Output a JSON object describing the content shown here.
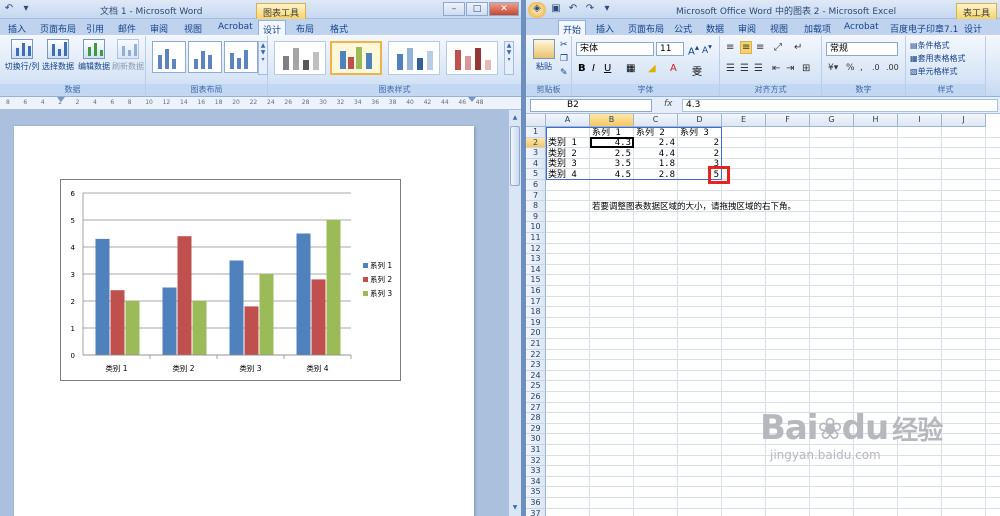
{
  "word": {
    "title": "文档 1 - Microsoft Word",
    "context_tab": "图表工具",
    "tabs": [
      "插入",
      "页面布局",
      "引用",
      "邮件",
      "审阅",
      "视图",
      "Acrobat",
      "设计",
      "布局",
      "格式"
    ],
    "active_tab": "设计",
    "data_group": {
      "label": "数据",
      "buttons": [
        "切换行/列",
        "选择数据",
        "编辑数据",
        "刷新数据"
      ]
    },
    "layout_group_label": "图表布局",
    "styles_group_label": "图表样式",
    "ruler_numbers": [
      "8",
      "6",
      "4",
      "2",
      "2",
      "4",
      "6",
      "8",
      "10",
      "12",
      "14",
      "16",
      "18",
      "20",
      "22",
      "24",
      "26",
      "28",
      "30",
      "32",
      "34",
      "36",
      "38",
      "40",
      "42",
      "44",
      "46",
      "48"
    ]
  },
  "excel": {
    "title": "Microsoft Office Word 中的图表 2 - Microsoft Excel",
    "context_tab": "表工具",
    "tabs": [
      "开始",
      "插入",
      "页面布局",
      "公式",
      "数据",
      "审阅",
      "视图",
      "加载项",
      "Acrobat",
      "百度电子印章7.1",
      "设计"
    ],
    "active_tab": "开始",
    "font_name": "宋体",
    "font_size": "11",
    "number_format": "常规",
    "paste_label": "粘贴",
    "styles_buttons": [
      "条件格式",
      "套用表格格式",
      "单元格样式"
    ],
    "group_labels": [
      "剪贴板",
      "字体",
      "对齐方式",
      "数字",
      "样式"
    ],
    "name_box": "B2",
    "formula_value": "4.3",
    "columns": [
      "A",
      "B",
      "C",
      "D",
      "E",
      "F",
      "G",
      "H",
      "I",
      "J"
    ],
    "row_numbers": [
      "1",
      "2",
      "3",
      "4",
      "5",
      "6",
      "7",
      "8",
      "9",
      "10",
      "11",
      "12",
      "13",
      "14",
      "15",
      "16",
      "17",
      "18",
      "19",
      "20",
      "21",
      "22",
      "23",
      "24",
      "25",
      "26",
      "27",
      "28",
      "29",
      "30",
      "31",
      "32",
      "33",
      "34",
      "35",
      "36",
      "37"
    ],
    "header_row": [
      "",
      "系列 1",
      "系列 2",
      "系列 3"
    ],
    "rows": [
      [
        "类别 1",
        "4.3",
        "2.4",
        "2"
      ],
      [
        "类别 2",
        "2.5",
        "4.4",
        "2"
      ],
      [
        "类别 3",
        "3.5",
        "1.8",
        "3"
      ],
      [
        "类别 4",
        "4.5",
        "2.8",
        "5"
      ]
    ],
    "note": "若要调整图表数据区域的大小，请拖拽区域的右下角。"
  },
  "watermark": {
    "brand": "Bai",
    "brand2": "du",
    "cn": "经验",
    "url": "jingyan.baidu.com"
  },
  "chart_data": {
    "type": "bar",
    "categories": [
      "类别 1",
      "类别 2",
      "类别 3",
      "类别 4"
    ],
    "series": [
      {
        "name": "系列 1",
        "values": [
          4.3,
          2.5,
          3.5,
          4.5
        ],
        "color": "#4f81bd"
      },
      {
        "name": "系列 2",
        "values": [
          2.4,
          4.4,
          1.8,
          2.8
        ],
        "color": "#c0504d"
      },
      {
        "name": "系列 3",
        "values": [
          2,
          2,
          3,
          5
        ],
        "color": "#9bbb59"
      }
    ],
    "ylim": [
      0,
      6
    ],
    "yticks": [
      "0",
      "1",
      "2",
      "3",
      "4",
      "5",
      "6"
    ],
    "grid": true,
    "legend": "right"
  }
}
